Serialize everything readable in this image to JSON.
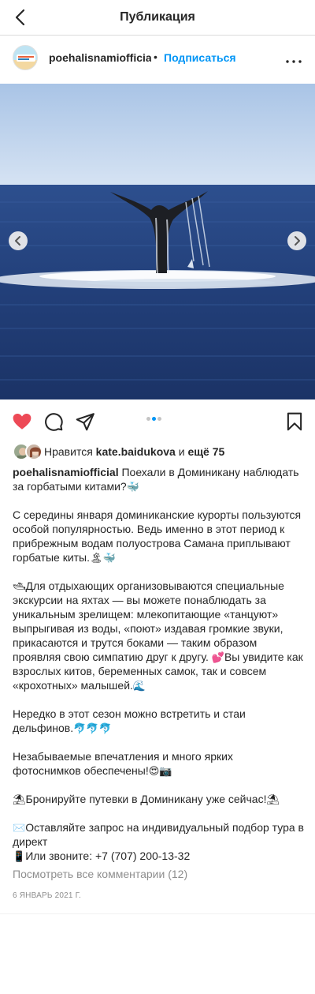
{
  "header": {
    "title": "Публикация",
    "back_icon": "chevron-left-icon"
  },
  "author": {
    "username": "poehalisnamiofficial",
    "separator": "•",
    "follow_label": "Подписаться",
    "avatar_text": "Поехали с нами"
  },
  "carousel": {
    "total": 3,
    "active_index": 1
  },
  "actions": {
    "like_color": "#ed4956",
    "accent": "#0095f6"
  },
  "likes": {
    "prefix": "Нравится",
    "user": "kate.baidukova",
    "connector": "и",
    "more": "ещё 75"
  },
  "caption": {
    "author": "poehalisnamiofficial",
    "lines": [
      {
        "text": "Поехали в Доминикану наблюдать за горбатыми китами?",
        "emoji": " 🐳"
      },
      {
        "text": "С середины января доминиканские курорты пользуются особой популярностью. Ведь именно в этот период к прибрежным водам полуострова Самана приплывают горбатые киты.",
        "emoji": " 🏝🐳"
      },
      {
        "emoji_before": "🛥",
        "text": "Для отдыхающих организовываются специальные экскурсии на яхтах — вы можете понаблюдать за уникальным зрелищем: млекопитающие «танцуют» выпрыгивая из воды, «поют» издавая громкие звуки, прикасаются и трутся боками — таким образом проявляя свою симпатию друг к другу.",
        "emoji_mid": "💕",
        "text2": "Вы увидите как взрослых китов, беременных самок, так и совсем «крохотных» малышей.",
        "emoji": " 🌊"
      },
      {
        "text": "Нередко в этот сезон можно встретить и стаи дельфинов.",
        "emoji": " 🐬🐬🐬"
      },
      {
        "text": "Незабываемые впечатления и много ярких фотоснимков обеспечены!",
        "emoji": " 😍📷"
      },
      {
        "emoji_before": "⛱",
        "text": "Бронируйте путевки в Доминикану уже сейчас!",
        "emoji": " ⛱"
      },
      {
        "emoji_before": "✉️",
        "text": "Оставляйте запрос на индивидуальный подбор тура в директ",
        "emoji_line2": "📱",
        "text2": "Или звоните: +7 (707) 200-13-32"
      }
    ]
  },
  "comments": {
    "view_all": "Посмотреть все комментарии (12)"
  },
  "date": "6 ЯНВАРЬ 2021 Г."
}
